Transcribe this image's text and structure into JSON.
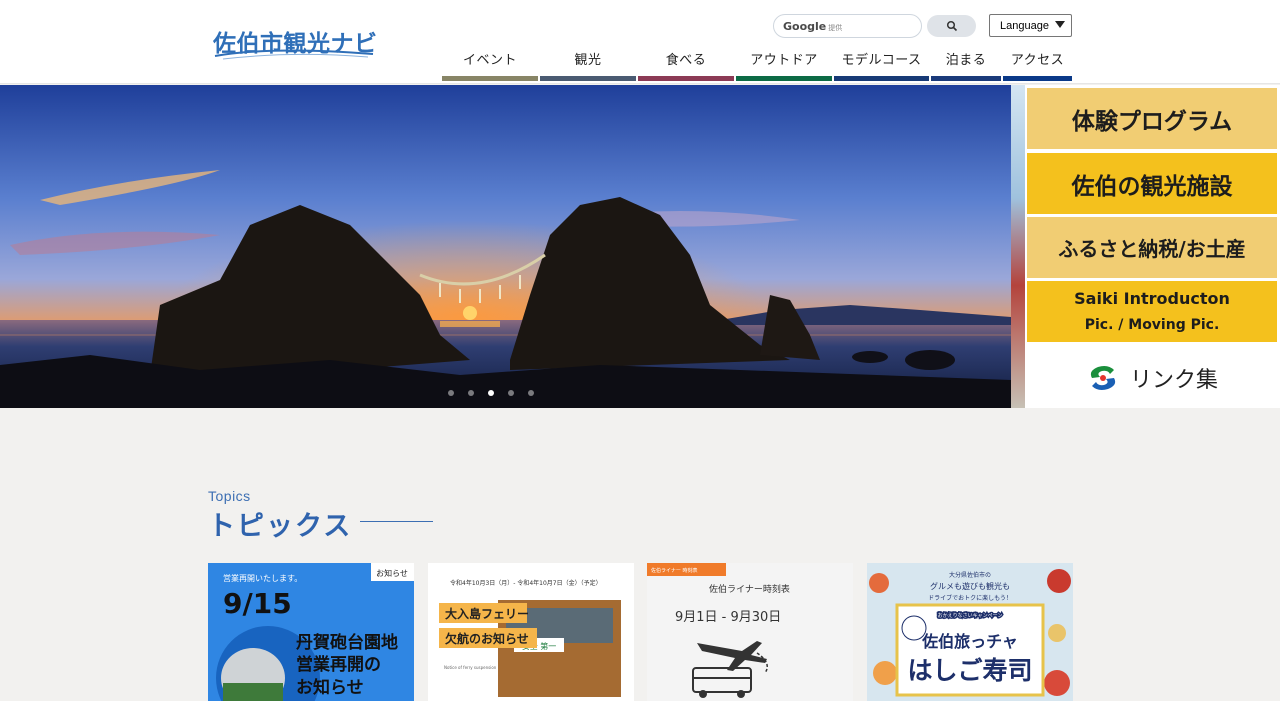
{
  "header": {
    "logo_text": "佐伯市観光ナビ",
    "search": {
      "google_label": "Google",
      "sub_label": "提供",
      "button_icon": "search-icon"
    },
    "language_select": {
      "selected": "Language"
    },
    "nav": [
      {
        "label": "イベント",
        "color": "#888566"
      },
      {
        "label": "観光",
        "color": "#4a5b72"
      },
      {
        "label": "食べる",
        "color": "#8c3a55"
      },
      {
        "label": "アウトドア",
        "color": "#0d6b45"
      },
      {
        "label": "モデルコース",
        "color": "#173a76"
      },
      {
        "label": "泊まる",
        "color": "#1a3a7a"
      },
      {
        "label": "アクセス",
        "color": "#0a3988"
      }
    ]
  },
  "hero": {
    "carousel_dots": 5,
    "active_dot": 3
  },
  "side_banners": {
    "experience": "体験プログラム",
    "facilities": "佐伯の観光施設",
    "furusato": "ふるさと納税/お土産",
    "intro_title": "Saiki Introducton",
    "intro_sub": "Pic. / Moving Pic.",
    "links": "リンク集"
  },
  "topics": {
    "heading_en": "Topics",
    "heading_jp": "トピックス",
    "cards": [
      {
        "tag": "お知らせ",
        "top_note": "営業再開いたします。",
        "date": "9/15",
        "line1": "丹賀砲台園地",
        "line2": "営業再開の",
        "line3": "お知らせ"
      },
      {
        "date_range": "令和4年10月3日（月）- 令和4年10月7日（金）（予定）",
        "line1": "大入島フェリー",
        "line2": "欠航のお知らせ",
        "sign": "安全 第一",
        "small_note": "Notice of ferry suspension"
      },
      {
        "tag": "佐伯ライナー 時刻表",
        "title": "佐伯ライナー時刻表",
        "dates": "9月1日 - 9月30日"
      },
      {
        "top": "大分県佐伯市の",
        "mid": "グルメも遊びも観光も",
        "small": "ドライブでおトクに楽しもう！",
        "campaign": "おかえりなさいキャンペーン",
        "title1": "佐伯旅っチャ",
        "title2": "はしご寿司"
      }
    ]
  }
}
